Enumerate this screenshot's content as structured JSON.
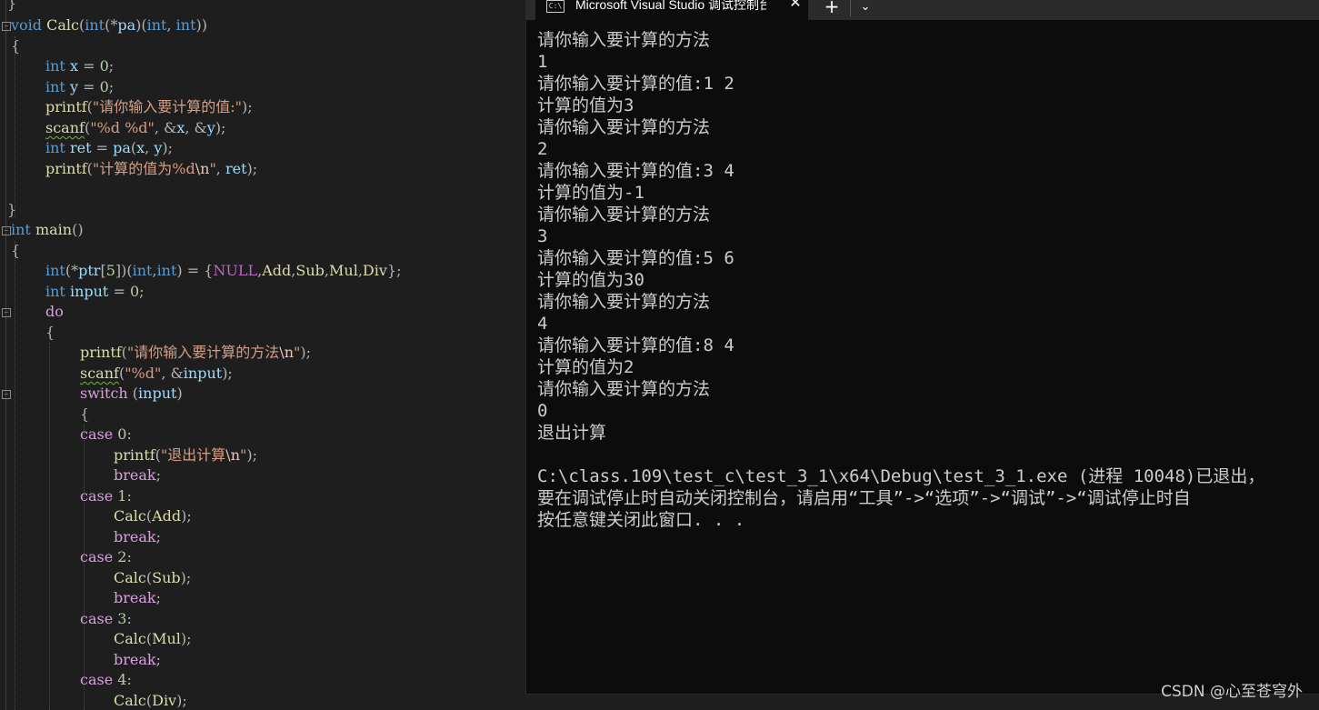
{
  "editor": {
    "lines": [
      [
        [
          "}",
          "pun"
        ]
      ],
      [
        [
          "void",
          "kw"
        ],
        [
          " ",
          "plain"
        ],
        [
          "Calc",
          "fn"
        ],
        [
          "(",
          "pun"
        ],
        [
          "int",
          "kw"
        ],
        [
          "(*",
          "pun"
        ],
        [
          "pa",
          "var"
        ],
        [
          ")(",
          "pun"
        ],
        [
          "int",
          "kw"
        ],
        [
          ", ",
          "pun"
        ],
        [
          "int",
          "kw"
        ],
        [
          "))",
          "pun"
        ]
      ],
      [
        [
          "{",
          "pun"
        ]
      ],
      [
        [
          "int",
          "kw"
        ],
        [
          " ",
          "plain"
        ],
        [
          "x",
          "var"
        ],
        [
          " = ",
          "pun"
        ],
        [
          "0",
          "num"
        ],
        [
          ";",
          "pun"
        ]
      ],
      [
        [
          "int",
          "kw"
        ],
        [
          " ",
          "plain"
        ],
        [
          "y",
          "var"
        ],
        [
          " = ",
          "pun"
        ],
        [
          "0",
          "num"
        ],
        [
          ";",
          "pun"
        ]
      ],
      [
        [
          "printf",
          "fn"
        ],
        [
          "(",
          "pun"
        ],
        [
          "\"请你输入要计算的值:\"",
          "str"
        ],
        [
          ");",
          "pun"
        ]
      ],
      [
        [
          "scanf",
          "fn squig"
        ],
        [
          "(",
          "pun"
        ],
        [
          "\"%d %d\"",
          "str"
        ],
        [
          ", &",
          "pun"
        ],
        [
          "x",
          "var"
        ],
        [
          ", &",
          "pun"
        ],
        [
          "y",
          "var"
        ],
        [
          ");",
          "pun"
        ]
      ],
      [
        [
          "int",
          "kw"
        ],
        [
          " ",
          "plain"
        ],
        [
          "ret",
          "var"
        ],
        [
          " = ",
          "pun"
        ],
        [
          "pa",
          "var"
        ],
        [
          "(",
          "pun"
        ],
        [
          "x",
          "var"
        ],
        [
          ", ",
          "pun"
        ],
        [
          "y",
          "var"
        ],
        [
          ");",
          "pun"
        ]
      ],
      [
        [
          "printf",
          "fn"
        ],
        [
          "(",
          "pun"
        ],
        [
          "\"计算的值为%d",
          "str"
        ],
        [
          "\\n",
          "esc"
        ],
        [
          "\"",
          "str"
        ],
        [
          ", ",
          "pun"
        ],
        [
          "ret",
          "var"
        ],
        [
          ");",
          "pun"
        ]
      ],
      [],
      [
        [
          "}",
          "pun"
        ]
      ],
      [
        [
          "int",
          "kw"
        ],
        [
          " ",
          "plain"
        ],
        [
          "main",
          "fn"
        ],
        [
          "()",
          "pun"
        ]
      ],
      [
        [
          "{",
          "pun"
        ]
      ],
      [
        [
          "int",
          "kw"
        ],
        [
          "(*",
          "pun"
        ],
        [
          "ptr",
          "var"
        ],
        [
          "[",
          "pun"
        ],
        [
          "5",
          "num"
        ],
        [
          "])(",
          "pun"
        ],
        [
          "int",
          "kw"
        ],
        [
          ",",
          "pun"
        ],
        [
          "int",
          "kw"
        ],
        [
          ") = {",
          "pun"
        ],
        [
          "NULL",
          "mac"
        ],
        [
          ",",
          "pun"
        ],
        [
          "Add",
          "fn"
        ],
        [
          ",",
          "pun"
        ],
        [
          "Sub",
          "fn"
        ],
        [
          ",",
          "pun"
        ],
        [
          "Mul",
          "fn"
        ],
        [
          ",",
          "pun"
        ],
        [
          "Div",
          "fn"
        ],
        [
          "};",
          "pun"
        ]
      ],
      [
        [
          "int",
          "kw"
        ],
        [
          " ",
          "plain"
        ],
        [
          "input",
          "var"
        ],
        [
          " = ",
          "pun"
        ],
        [
          "0",
          "num"
        ],
        [
          ";",
          "pun"
        ]
      ],
      [
        [
          "do",
          "ctl"
        ]
      ],
      [
        [
          "{",
          "pun"
        ]
      ],
      [
        [
          "printf",
          "fn"
        ],
        [
          "(",
          "pun"
        ],
        [
          "\"请你输入要计算的方法",
          "str"
        ],
        [
          "\\n",
          "esc"
        ],
        [
          "\"",
          "str"
        ],
        [
          ");",
          "pun"
        ]
      ],
      [
        [
          "scanf",
          "fn squig"
        ],
        [
          "(",
          "pun"
        ],
        [
          "\"%d\"",
          "str"
        ],
        [
          ", &",
          "pun"
        ],
        [
          "input",
          "var"
        ],
        [
          ");",
          "pun"
        ]
      ],
      [
        [
          "switch",
          "ctl"
        ],
        [
          " (",
          "pun"
        ],
        [
          "input",
          "var"
        ],
        [
          ")",
          "pun"
        ]
      ],
      [
        [
          "{",
          "pun"
        ]
      ],
      [
        [
          "case",
          "ctl"
        ],
        [
          " ",
          "plain"
        ],
        [
          "0",
          "num"
        ],
        [
          ":",
          "pun"
        ]
      ],
      [
        [
          "printf",
          "fn"
        ],
        [
          "(",
          "pun"
        ],
        [
          "\"退出计算",
          "str"
        ],
        [
          "\\n",
          "esc"
        ],
        [
          "\"",
          "str"
        ],
        [
          ");",
          "pun"
        ]
      ],
      [
        [
          "break",
          "ctl"
        ],
        [
          ";",
          "pun"
        ]
      ],
      [
        [
          "case",
          "ctl"
        ],
        [
          " ",
          "plain"
        ],
        [
          "1",
          "num"
        ],
        [
          ":",
          "pun"
        ]
      ],
      [
        [
          "Calc",
          "fn"
        ],
        [
          "(",
          "pun"
        ],
        [
          "Add",
          "fn"
        ],
        [
          ");",
          "pun"
        ]
      ],
      [
        [
          "break",
          "ctl"
        ],
        [
          ";",
          "pun"
        ]
      ],
      [
        [
          "case",
          "ctl"
        ],
        [
          " ",
          "plain"
        ],
        [
          "2",
          "num"
        ],
        [
          ":",
          "pun"
        ]
      ],
      [
        [
          "Calc",
          "fn"
        ],
        [
          "(",
          "pun"
        ],
        [
          "Sub",
          "fn"
        ],
        [
          ");",
          "pun"
        ]
      ],
      [
        [
          "break",
          "ctl"
        ],
        [
          ";",
          "pun"
        ]
      ],
      [
        [
          "case",
          "ctl"
        ],
        [
          " ",
          "plain"
        ],
        [
          "3",
          "num"
        ],
        [
          ":",
          "pun"
        ]
      ],
      [
        [
          "Calc",
          "fn"
        ],
        [
          "(",
          "pun"
        ],
        [
          "Mul",
          "fn"
        ],
        [
          ");",
          "pun"
        ]
      ],
      [
        [
          "break",
          "ctl"
        ],
        [
          ";",
          "pun"
        ]
      ],
      [
        [
          "case",
          "ctl"
        ],
        [
          " ",
          "plain"
        ],
        [
          "4",
          "num"
        ],
        [
          ":",
          "pun"
        ]
      ],
      [
        [
          "Calc",
          "fn"
        ],
        [
          "(",
          "pun"
        ],
        [
          "Div",
          "fn"
        ],
        [
          ");",
          "pun"
        ]
      ]
    ]
  },
  "console": {
    "tab_title": "Microsoft Visual Studio 调试控制台",
    "tab_icon_text": "C:\\",
    "close_glyph": "✕",
    "new_tab_glyph": "+",
    "dropdown_glyph": "⌄",
    "output_lines": [
      "请你输入要计算的方法",
      "1",
      "请你输入要计算的值:1 2",
      "计算的值为3",
      "请你输入要计算的方法",
      "2",
      "请你输入要计算的值:3 4",
      "计算的值为-1",
      "请你输入要计算的方法",
      "3",
      "请你输入要计算的值:5 6",
      "计算的值为30",
      "请你输入要计算的方法",
      "4",
      "请你输入要计算的值:8 4",
      "计算的值为2",
      "请你输入要计算的方法",
      "0",
      "退出计算",
      "",
      "C:\\class.109\\test_c\\test_3_1\\x64\\Debug\\test_3_1.exe (进程 10048)已退出，",
      "要在调试停止时自动关闭控制台，请启用“工具”->“选项”->“调试”->“调试停止时自",
      "按任意键关闭此窗口. . ."
    ]
  },
  "watermark": "CSDN @心至苍穹外"
}
